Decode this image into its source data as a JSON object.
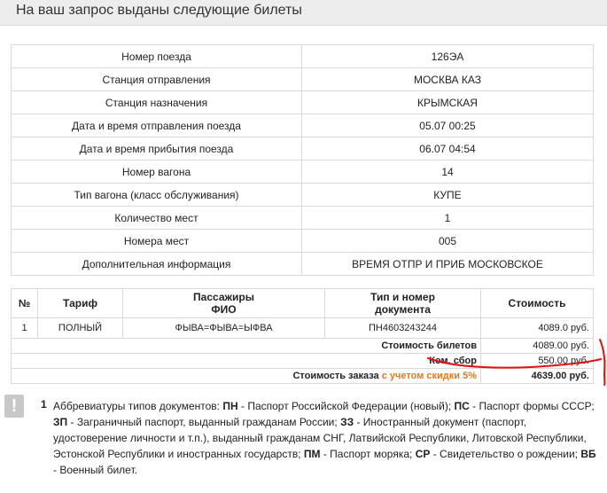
{
  "header": {
    "title": "На ваш запрос выданы следующие билеты"
  },
  "train_info": [
    {
      "label": "Номер поезда",
      "value": "126ЭА"
    },
    {
      "label": "Станция отправления",
      "value": "МОСКВА КАЗ"
    },
    {
      "label": "Станция назначения",
      "value": "КРЫМСКАЯ"
    },
    {
      "label": "Дата и время отправления поезда",
      "value": "05.07 00:25"
    },
    {
      "label": "Дата и время прибытия поезда",
      "value": "06.07 04:54"
    },
    {
      "label": "Номер вагона",
      "value": "14"
    },
    {
      "label": "Тип вагона (класс обслуживания)",
      "value": "КУПЕ"
    },
    {
      "label": "Количество мест",
      "value": "1"
    },
    {
      "label": "Номера мест",
      "value": "005"
    },
    {
      "label": "Дополнительная информация",
      "value": "ВРЕМЯ ОТПР И ПРИБ МОСКОВСКОЕ"
    }
  ],
  "tickets": {
    "headers": {
      "num": "№",
      "tariff": "Тариф",
      "passengers_1": "Пассажиры",
      "passengers_2": "ФИО",
      "doc_1": "Тип и номер",
      "doc_2": "документа",
      "cost": "Стоимость"
    },
    "row": {
      "num": "1",
      "tariff": "ПОЛНЫЙ",
      "passenger": "ФЫВА=ФЫВА=ЫФВА",
      "document": "ПН4603243244",
      "cost": "4089.0 руб."
    },
    "summary": {
      "tickets_cost_label": "Стоимость билетов",
      "tickets_cost_value": "4089.00 руб.",
      "fee_label": "Ком. сбор",
      "fee_value": "550.00 руб.",
      "order_cost_label": "Стоимость заказа",
      "discount_label": "с учетом скидки 5%",
      "order_cost_value": "4639.00 руб."
    }
  },
  "note": {
    "icon": "exclamation-icon",
    "number": "1",
    "t1": "Аббревиатуры типов документов: ",
    "a1": "ПН",
    "t2": " - Паспорт Российской Федерации (новый); ",
    "a2": "ПС",
    "t3": " - Паспорт формы СССР; ",
    "a3": "ЗП",
    "t4": " - Заграничный паспорт, выданный гражданам России; ",
    "a4": "ЗЗ",
    "t5": " - Иностранный документ (паспорт, удостоверение личности и т.п.), выданный гражданам СНГ, Латвийской Республики, Литовской Республики, Эстонской Республики и иностранных государств; ",
    "a5": "ПМ",
    "t6": " - Паспорт моряка; ",
    "a6": "СР",
    "t7": " - Свидетельство о рождении; ",
    "a7": "ВБ",
    "t8": " - Военный билет."
  },
  "colors": {
    "discount": "#e07a1e",
    "annotation": "#e01010",
    "header_bg": "#ededed"
  }
}
